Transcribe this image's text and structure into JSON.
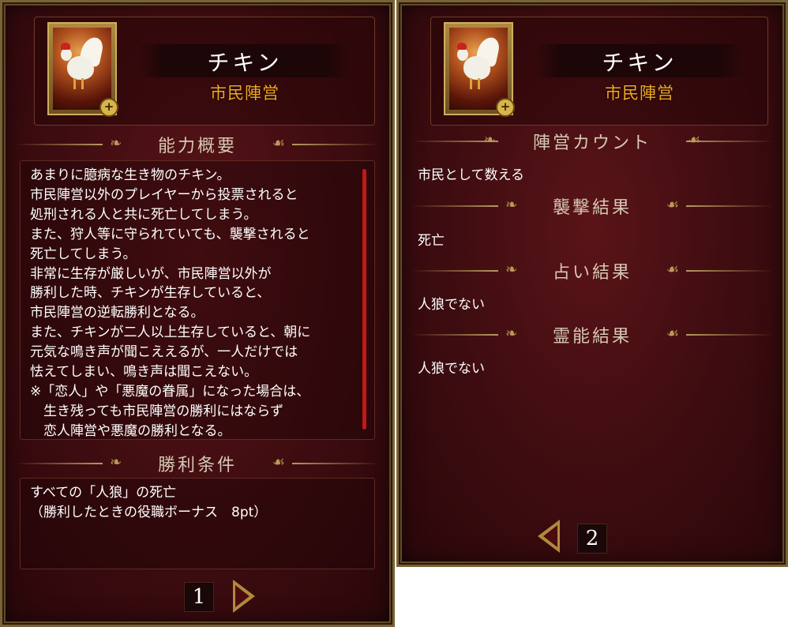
{
  "colors": {
    "panel_bg": "#3d0c10",
    "frame_gold": "#7a6236",
    "faction_orange": "#f2a81e",
    "heading": "#d7c8b4",
    "body_text": "#ffffff",
    "scrollbar": "#c21818"
  },
  "page1": {
    "character": {
      "name": "チキン",
      "faction": "市民陣営",
      "portrait_icon": "white-rooster-portrait",
      "zoom_icon": "magnify-plus-icon"
    },
    "ability": {
      "heading": "能力概要",
      "lines": [
        "あまりに臆病な生き物のチキン。",
        "市民陣営以外のプレイヤーから投票されると",
        "処刑される人と共に死亡してしまう。",
        "また、狩人等に守られていても、襲撃されると",
        "死亡してしまう。",
        "非常に生存が厳しいが、市民陣営以外が",
        "勝利した時、チキンが生存していると、",
        "市民陣営の逆転勝利となる。",
        "また、チキンが二人以上生存していると、朝に",
        "元気な鳴き声が聞こええるが、一人だけでは",
        "怯えてしまい、鳴き声は聞こえない。",
        "※「恋人」や「悪魔の眷属」になった場合は、",
        "　生き残っても市民陣営の勝利にはならず",
        "　恋人陣営や悪魔の勝利となる。"
      ]
    },
    "victory": {
      "heading": "勝利条件",
      "line1": "すべての「人狼」の死亡",
      "line2": "（勝利したときの役職ボーナス　8pt）"
    },
    "page_number": "1"
  },
  "page2": {
    "character": {
      "name": "チキン",
      "faction": "市民陣営"
    },
    "count": {
      "heading": "陣営カウント",
      "value": "市民として数える"
    },
    "attack": {
      "heading": "襲撃結果",
      "value": "死亡"
    },
    "divination": {
      "heading": "占い結果",
      "value": "人狼でない"
    },
    "medium": {
      "heading": "霊能結果",
      "value": "人狼でない"
    },
    "page_number": "2"
  }
}
